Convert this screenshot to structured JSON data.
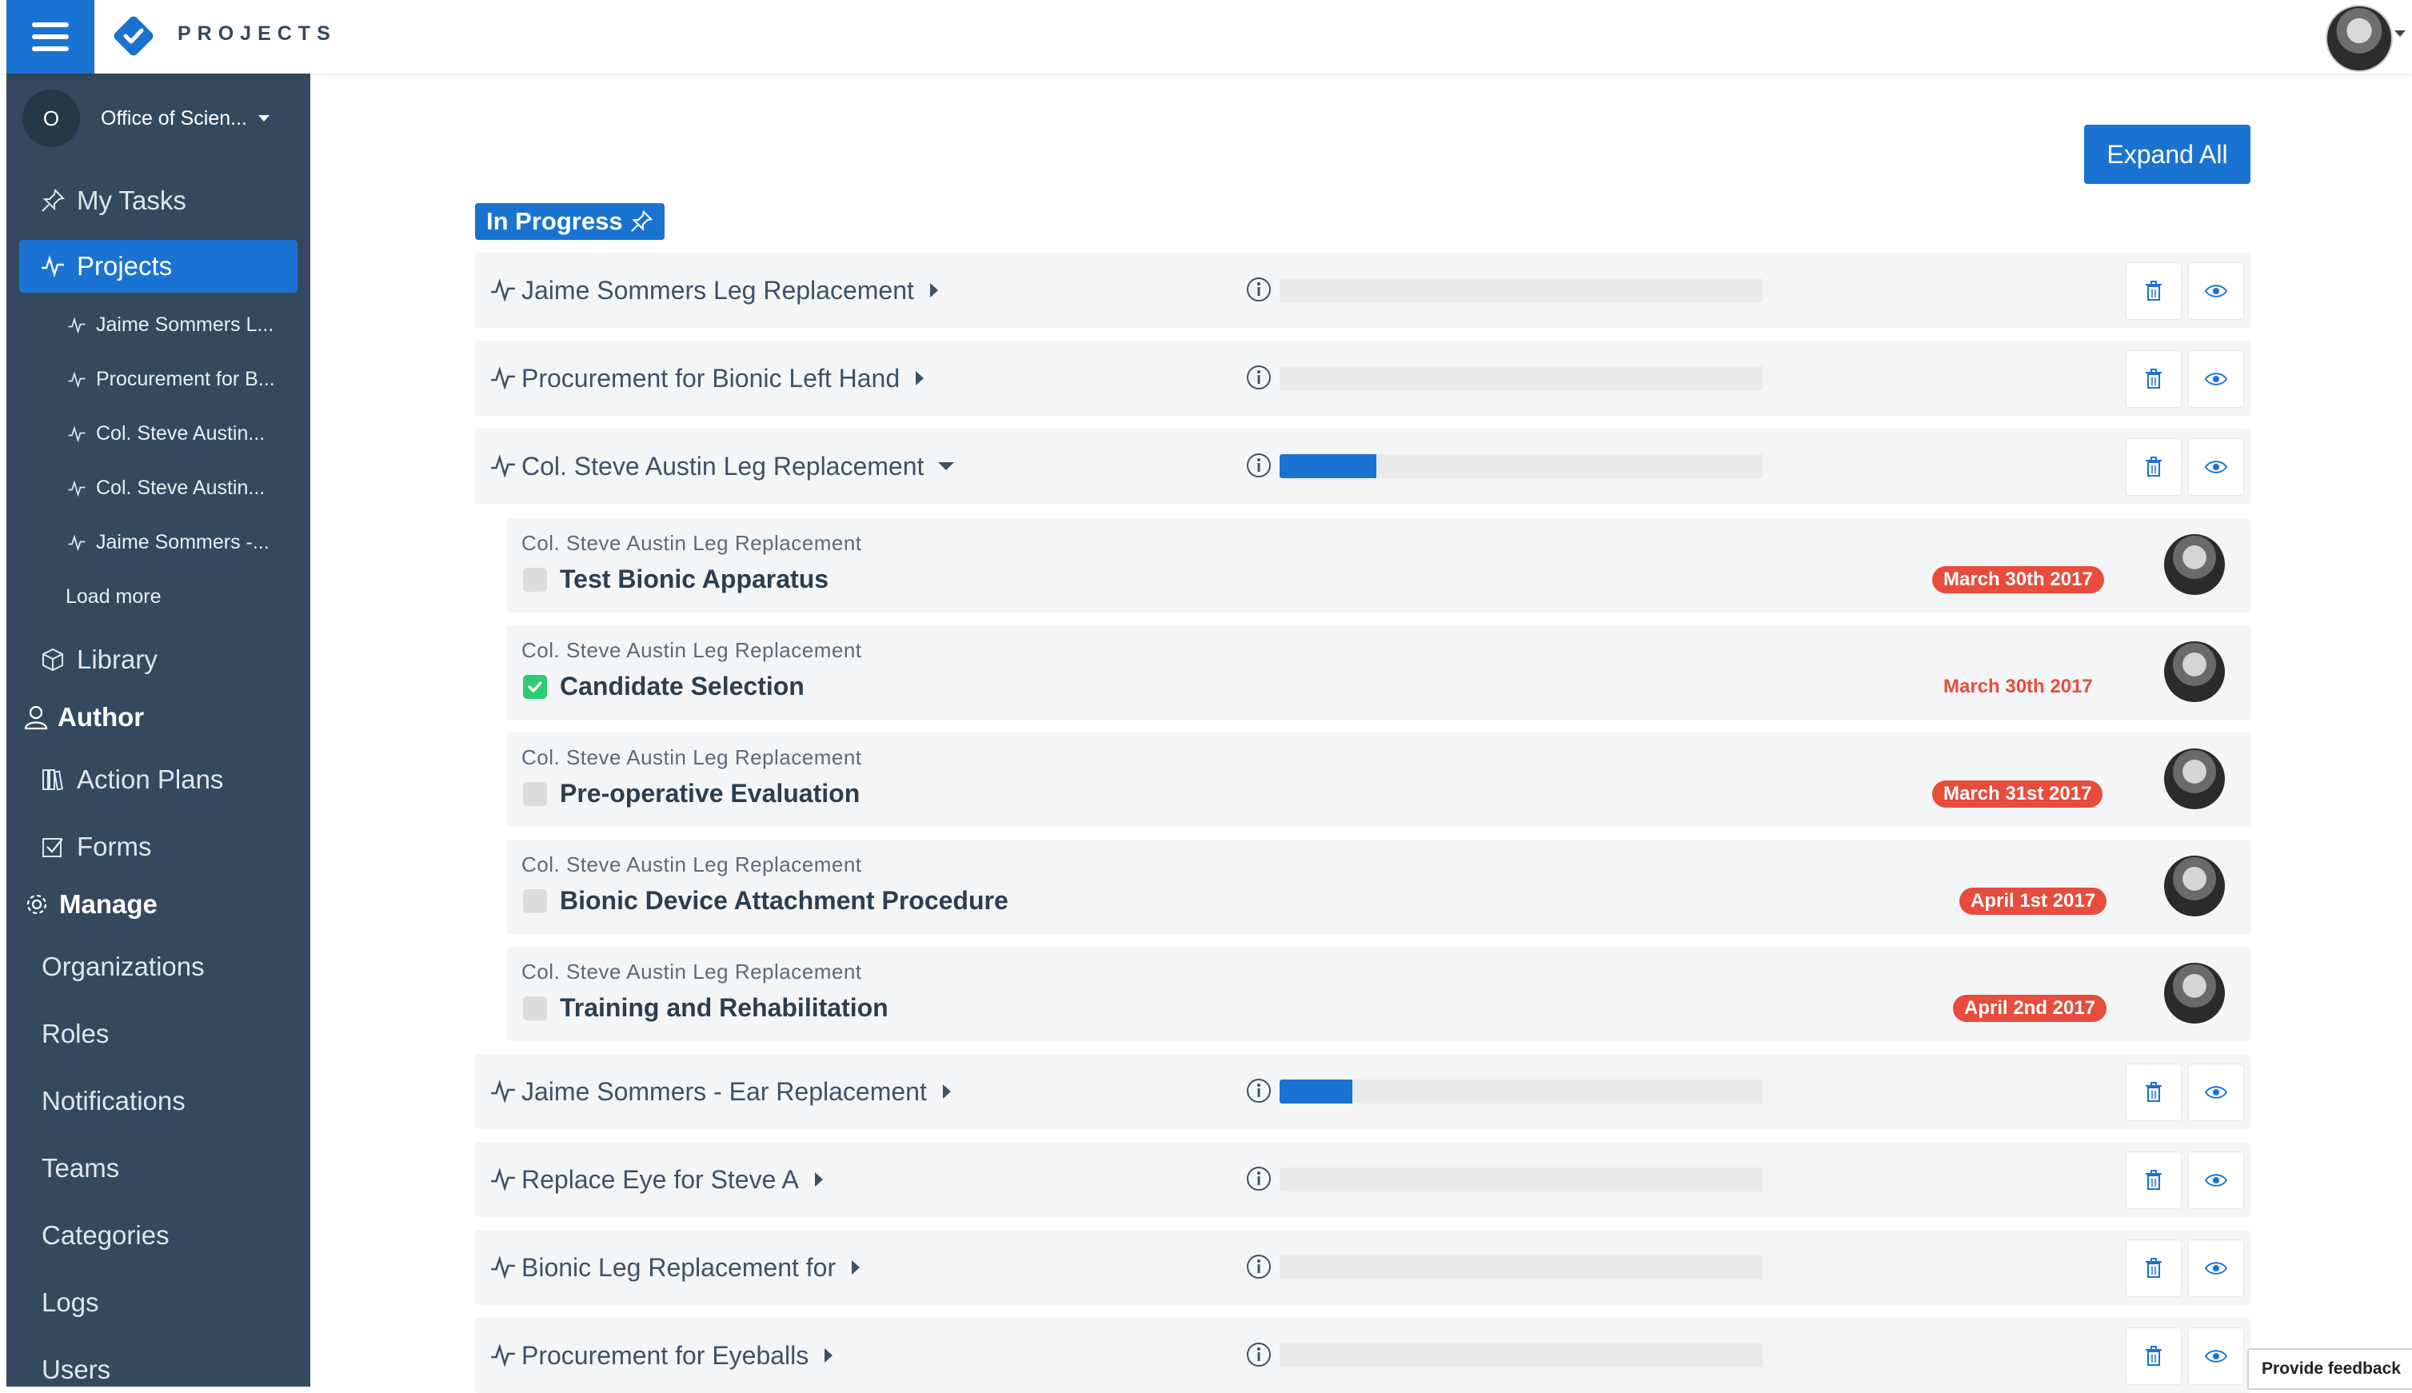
{
  "header": {
    "app_title": "PROJECTS",
    "menu_icon": "hamburger-icon",
    "logo_icon": "check-diamond-logo"
  },
  "sidebar": {
    "org_initial": "O",
    "org_name": "Office of Scien...",
    "my_tasks": "My Tasks",
    "projects": "Projects",
    "project_items": [
      "Jaime Sommers L...",
      "Procurement for B...",
      "Col. Steve Austin...",
      "Col. Steve Austin...",
      "Jaime Sommers -..."
    ],
    "load_more": "Load more",
    "library": "Library",
    "author": "Author",
    "action_plans": "Action Plans",
    "forms": "Forms",
    "manage": "Manage",
    "manage_items": [
      "Organizations",
      "Roles",
      "Notifications",
      "Teams",
      "Categories",
      "Logs",
      "Users"
    ]
  },
  "main": {
    "expand_all": "Expand All",
    "section_label": "In Progress",
    "projects": [
      {
        "title": "Jaime Sommers Leg Replacement",
        "progress": 0
      },
      {
        "title": "Procurement for Bionic Left Hand",
        "progress": 0
      },
      {
        "title": "Col. Steve Austin Leg Replacement",
        "progress": 20,
        "expanded": true
      },
      {
        "title": "Jaime Sommers - Ear Replacement",
        "progress": 15
      },
      {
        "title": "Replace Eye for Steve A",
        "progress": 0
      },
      {
        "title": "Bionic Leg Replacement for",
        "progress": 0
      },
      {
        "title": "Procurement for Eyeballs",
        "progress": 0
      }
    ],
    "tasks": [
      {
        "parent": "Col. Steve Austin Leg Replacement",
        "title": "Test Bionic Apparatus",
        "date": "March 30th 2017",
        "done": false,
        "overdue": true
      },
      {
        "parent": "Col. Steve Austin Leg Replacement",
        "title": "Candidate Selection",
        "date": "March 30th 2017",
        "done": true,
        "overdue": false
      },
      {
        "parent": "Col. Steve Austin Leg Replacement",
        "title": "Pre-operative Evaluation",
        "date": "March 31st 2017",
        "done": false,
        "overdue": true
      },
      {
        "parent": "Col. Steve Austin Leg Replacement",
        "title": "Bionic Device Attachment Procedure",
        "date": "April 1st 2017",
        "done": false,
        "overdue": true
      },
      {
        "parent": "Col. Steve Austin Leg Replacement",
        "title": "Training and Rehabilitation",
        "date": "April 2nd 2017",
        "done": false,
        "overdue": true
      }
    ]
  },
  "feedback": "Provide feedback",
  "colors": {
    "primary": "#1a73d1",
    "sidebar": "#34495e",
    "danger": "#e74c3c",
    "success": "#2ecc71",
    "row_bg": "#f4f5f7"
  }
}
